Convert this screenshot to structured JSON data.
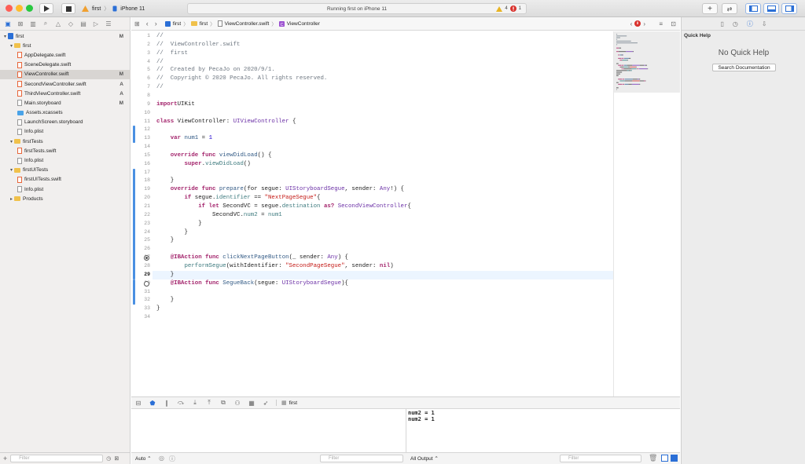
{
  "toolbar": {
    "scheme_project": "first",
    "scheme_device": "iPhone 11",
    "status": "Running first on iPhone 11",
    "warning_count": "4",
    "error_count": "1"
  },
  "navigator": {
    "items": [
      {
        "label": "first",
        "depth": 0,
        "kind": "project",
        "badge": "M",
        "expanded": true
      },
      {
        "label": "first",
        "depth": 1,
        "kind": "folder",
        "badge": "",
        "expanded": true
      },
      {
        "label": "AppDelegate.swift",
        "depth": 2,
        "kind": "swift",
        "badge": ""
      },
      {
        "label": "SceneDelegate.swift",
        "depth": 2,
        "kind": "swift",
        "badge": ""
      },
      {
        "label": "ViewController.swift",
        "depth": 2,
        "kind": "swift",
        "badge": "M",
        "selected": true
      },
      {
        "label": "SecondViewController.swift",
        "depth": 2,
        "kind": "swift",
        "badge": "A"
      },
      {
        "label": "ThirdViewController.swift",
        "depth": 2,
        "kind": "swift",
        "badge": "A"
      },
      {
        "label": "Main.storyboard",
        "depth": 2,
        "kind": "storyboard",
        "badge": "M"
      },
      {
        "label": "Assets.xcassets",
        "depth": 2,
        "kind": "assets",
        "badge": ""
      },
      {
        "label": "LaunchScreen.storyboard",
        "depth": 2,
        "kind": "storyboard",
        "badge": ""
      },
      {
        "label": "Info.plist",
        "depth": 2,
        "kind": "plist",
        "badge": ""
      },
      {
        "label": "firstTests",
        "depth": 1,
        "kind": "folder",
        "badge": "",
        "expanded": true
      },
      {
        "label": "firstTests.swift",
        "depth": 2,
        "kind": "swift",
        "badge": ""
      },
      {
        "label": "Info.plist",
        "depth": 2,
        "kind": "plist",
        "badge": ""
      },
      {
        "label": "firstUITests",
        "depth": 1,
        "kind": "folder",
        "badge": "",
        "expanded": true
      },
      {
        "label": "firstUITests.swift",
        "depth": 2,
        "kind": "swift",
        "badge": ""
      },
      {
        "label": "Info.plist",
        "depth": 2,
        "kind": "plist",
        "badge": ""
      },
      {
        "label": "Products",
        "depth": 1,
        "kind": "folder",
        "badge": "",
        "expanded": false
      }
    ],
    "filter_placeholder": "Filter"
  },
  "jumpbar": {
    "crumbs": [
      "first",
      "first",
      "ViewController.swift",
      "ViewController"
    ]
  },
  "editor": {
    "current_line": 29,
    "lines": [
      [
        [
          "cm",
          "//"
        ]
      ],
      [
        [
          "cm",
          "//  ViewController.swift"
        ]
      ],
      [
        [
          "cm",
          "//  first"
        ]
      ],
      [
        [
          "cm",
          "//"
        ]
      ],
      [
        [
          "cm",
          "//  Created by PecaJo on 2020/9/1."
        ]
      ],
      [
        [
          "cm",
          "//  Copyright © 2020 PecaJo. All rights reserved."
        ]
      ],
      [
        [
          "cm",
          "//"
        ]
      ],
      [],
      [
        [
          "kw",
          "import"
        ],
        [
          "",
          "UIKit"
        ]
      ],
      [],
      [
        [
          "kw",
          "class"
        ],
        [
          "",
          " ViewController: "
        ],
        [
          "ty",
          "UIViewController"
        ],
        [
          "",
          " {"
        ]
      ],
      [],
      [
        [
          "",
          "    "
        ],
        [
          "kw",
          "var"
        ],
        [
          "",
          " "
        ],
        [
          "fn",
          "num1"
        ],
        [
          "",
          " = "
        ],
        [
          "nm",
          "1"
        ]
      ],
      [],
      [
        [
          "",
          "    "
        ],
        [
          "kw",
          "override"
        ],
        [
          "",
          " "
        ],
        [
          "kw",
          "func"
        ],
        [
          "",
          " "
        ],
        [
          "fn",
          "viewDidLoad"
        ],
        [
          "",
          "() {"
        ]
      ],
      [
        [
          "",
          "        "
        ],
        [
          "kw",
          "super"
        ],
        [
          "",
          "."
        ],
        [
          "pr",
          "viewDidLoad"
        ],
        [
          "",
          "()"
        ]
      ],
      [],
      [
        [
          "",
          "    }"
        ]
      ],
      [
        [
          "",
          "    "
        ],
        [
          "kw",
          "override"
        ],
        [
          "",
          " "
        ],
        [
          "kw",
          "func"
        ],
        [
          "",
          " "
        ],
        [
          "fn",
          "prepare"
        ],
        [
          "",
          "(for segue: "
        ],
        [
          "ty",
          "UIStoryboardSegue"
        ],
        [
          "",
          ", sender: "
        ],
        [
          "ty",
          "Any"
        ],
        [
          "",
          "!) {"
        ]
      ],
      [
        [
          "",
          "        "
        ],
        [
          "kw",
          "if"
        ],
        [
          "",
          " segue."
        ],
        [
          "pr",
          "identifier"
        ],
        [
          "",
          " == "
        ],
        [
          "st",
          "\"NextPageSegue\""
        ],
        [
          "",
          "{"
        ]
      ],
      [
        [
          "",
          "            "
        ],
        [
          "kw",
          "if"
        ],
        [
          "",
          " "
        ],
        [
          "kw",
          "let"
        ],
        [
          "",
          " SecondVC = segue."
        ],
        [
          "pr",
          "destination"
        ],
        [
          "",
          " "
        ],
        [
          "kw",
          "as?"
        ],
        [
          "",
          " "
        ],
        [
          "ty",
          "SecondViewController"
        ],
        [
          "",
          "{"
        ]
      ],
      [
        [
          "",
          "                SecondVC."
        ],
        [
          "pr",
          "num2"
        ],
        [
          "",
          " = "
        ],
        [
          "pr",
          "num1"
        ]
      ],
      [
        [
          "",
          "            }"
        ]
      ],
      [
        [
          "",
          "        }"
        ]
      ],
      [
        [
          "",
          "    }"
        ]
      ],
      [],
      [
        [
          "",
          "    "
        ],
        [
          "kw",
          "@IBAction"
        ],
        [
          "",
          " "
        ],
        [
          "kw",
          "func"
        ],
        [
          "",
          " "
        ],
        [
          "fn",
          "clickNextPageButton"
        ],
        [
          "",
          "(_ sender: "
        ],
        [
          "ty",
          "Any"
        ],
        [
          "",
          ") {"
        ]
      ],
      [
        [
          "",
          "        "
        ],
        [
          "pr",
          "performSegue"
        ],
        [
          "",
          "(withIdentifier: "
        ],
        [
          "st",
          "\"SecondPageSegue\""
        ],
        [
          "",
          ", sender: "
        ],
        [
          "kw",
          "nil"
        ],
        [
          "",
          ")"
        ]
      ],
      [
        [
          "",
          "    }"
        ]
      ],
      [
        [
          "",
          "    "
        ],
        [
          "kw",
          "@IBAction"
        ],
        [
          "",
          " "
        ],
        [
          "kw",
          "func"
        ],
        [
          "",
          " "
        ],
        [
          "fn",
          "SegueBack"
        ],
        [
          "",
          "(segue: "
        ],
        [
          "ty",
          "UIStoryboardSegue"
        ],
        [
          "",
          "){"
        ]
      ],
      [],
      [
        [
          "",
          "    }"
        ]
      ],
      [
        [
          "",
          "}"
        ]
      ],
      []
    ]
  },
  "inspector": {
    "title": "Quick Help",
    "empty_text": "No Quick Help",
    "search_button": "Search Documentation"
  },
  "debug": {
    "target": "first",
    "scope": "Auto",
    "output_scope": "All Output",
    "filter_placeholder": "Filter",
    "console_lines": [
      "num2 = 1",
      "num2 = 1"
    ]
  },
  "colors": {
    "accent": "#4a90e2",
    "selection": "#d8d5d2",
    "error": "#d9322d",
    "warning": "#e8b423"
  }
}
